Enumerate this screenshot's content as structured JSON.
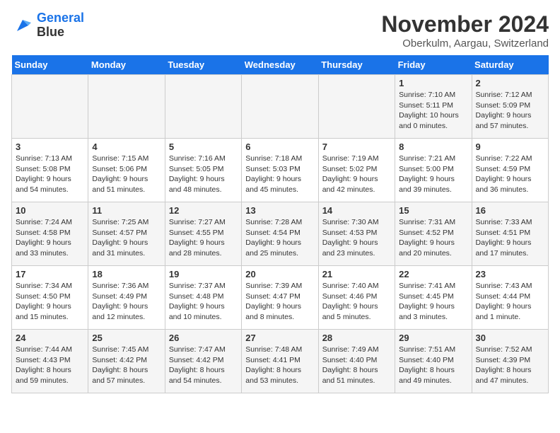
{
  "logo": {
    "line1": "General",
    "line2": "Blue"
  },
  "title": "November 2024",
  "subtitle": "Oberkulm, Aargau, Switzerland",
  "weekdays": [
    "Sunday",
    "Monday",
    "Tuesday",
    "Wednesday",
    "Thursday",
    "Friday",
    "Saturday"
  ],
  "weeks": [
    [
      {
        "day": "",
        "info": ""
      },
      {
        "day": "",
        "info": ""
      },
      {
        "day": "",
        "info": ""
      },
      {
        "day": "",
        "info": ""
      },
      {
        "day": "",
        "info": ""
      },
      {
        "day": "1",
        "info": "Sunrise: 7:10 AM\nSunset: 5:11 PM\nDaylight: 10 hours\nand 0 minutes."
      },
      {
        "day": "2",
        "info": "Sunrise: 7:12 AM\nSunset: 5:09 PM\nDaylight: 9 hours\nand 57 minutes."
      }
    ],
    [
      {
        "day": "3",
        "info": "Sunrise: 7:13 AM\nSunset: 5:08 PM\nDaylight: 9 hours\nand 54 minutes."
      },
      {
        "day": "4",
        "info": "Sunrise: 7:15 AM\nSunset: 5:06 PM\nDaylight: 9 hours\nand 51 minutes."
      },
      {
        "day": "5",
        "info": "Sunrise: 7:16 AM\nSunset: 5:05 PM\nDaylight: 9 hours\nand 48 minutes."
      },
      {
        "day": "6",
        "info": "Sunrise: 7:18 AM\nSunset: 5:03 PM\nDaylight: 9 hours\nand 45 minutes."
      },
      {
        "day": "7",
        "info": "Sunrise: 7:19 AM\nSunset: 5:02 PM\nDaylight: 9 hours\nand 42 minutes."
      },
      {
        "day": "8",
        "info": "Sunrise: 7:21 AM\nSunset: 5:00 PM\nDaylight: 9 hours\nand 39 minutes."
      },
      {
        "day": "9",
        "info": "Sunrise: 7:22 AM\nSunset: 4:59 PM\nDaylight: 9 hours\nand 36 minutes."
      }
    ],
    [
      {
        "day": "10",
        "info": "Sunrise: 7:24 AM\nSunset: 4:58 PM\nDaylight: 9 hours\nand 33 minutes."
      },
      {
        "day": "11",
        "info": "Sunrise: 7:25 AM\nSunset: 4:57 PM\nDaylight: 9 hours\nand 31 minutes."
      },
      {
        "day": "12",
        "info": "Sunrise: 7:27 AM\nSunset: 4:55 PM\nDaylight: 9 hours\nand 28 minutes."
      },
      {
        "day": "13",
        "info": "Sunrise: 7:28 AM\nSunset: 4:54 PM\nDaylight: 9 hours\nand 25 minutes."
      },
      {
        "day": "14",
        "info": "Sunrise: 7:30 AM\nSunset: 4:53 PM\nDaylight: 9 hours\nand 23 minutes."
      },
      {
        "day": "15",
        "info": "Sunrise: 7:31 AM\nSunset: 4:52 PM\nDaylight: 9 hours\nand 20 minutes."
      },
      {
        "day": "16",
        "info": "Sunrise: 7:33 AM\nSunset: 4:51 PM\nDaylight: 9 hours\nand 17 minutes."
      }
    ],
    [
      {
        "day": "17",
        "info": "Sunrise: 7:34 AM\nSunset: 4:50 PM\nDaylight: 9 hours\nand 15 minutes."
      },
      {
        "day": "18",
        "info": "Sunrise: 7:36 AM\nSunset: 4:49 PM\nDaylight: 9 hours\nand 12 minutes."
      },
      {
        "day": "19",
        "info": "Sunrise: 7:37 AM\nSunset: 4:48 PM\nDaylight: 9 hours\nand 10 minutes."
      },
      {
        "day": "20",
        "info": "Sunrise: 7:39 AM\nSunset: 4:47 PM\nDaylight: 9 hours\nand 8 minutes."
      },
      {
        "day": "21",
        "info": "Sunrise: 7:40 AM\nSunset: 4:46 PM\nDaylight: 9 hours\nand 5 minutes."
      },
      {
        "day": "22",
        "info": "Sunrise: 7:41 AM\nSunset: 4:45 PM\nDaylight: 9 hours\nand 3 minutes."
      },
      {
        "day": "23",
        "info": "Sunrise: 7:43 AM\nSunset: 4:44 PM\nDaylight: 9 hours\nand 1 minute."
      }
    ],
    [
      {
        "day": "24",
        "info": "Sunrise: 7:44 AM\nSunset: 4:43 PM\nDaylight: 8 hours\nand 59 minutes."
      },
      {
        "day": "25",
        "info": "Sunrise: 7:45 AM\nSunset: 4:42 PM\nDaylight: 8 hours\nand 57 minutes."
      },
      {
        "day": "26",
        "info": "Sunrise: 7:47 AM\nSunset: 4:42 PM\nDaylight: 8 hours\nand 54 minutes."
      },
      {
        "day": "27",
        "info": "Sunrise: 7:48 AM\nSunset: 4:41 PM\nDaylight: 8 hours\nand 53 minutes."
      },
      {
        "day": "28",
        "info": "Sunrise: 7:49 AM\nSunset: 4:40 PM\nDaylight: 8 hours\nand 51 minutes."
      },
      {
        "day": "29",
        "info": "Sunrise: 7:51 AM\nSunset: 4:40 PM\nDaylight: 8 hours\nand 49 minutes."
      },
      {
        "day": "30",
        "info": "Sunrise: 7:52 AM\nSunset: 4:39 PM\nDaylight: 8 hours\nand 47 minutes."
      }
    ]
  ]
}
